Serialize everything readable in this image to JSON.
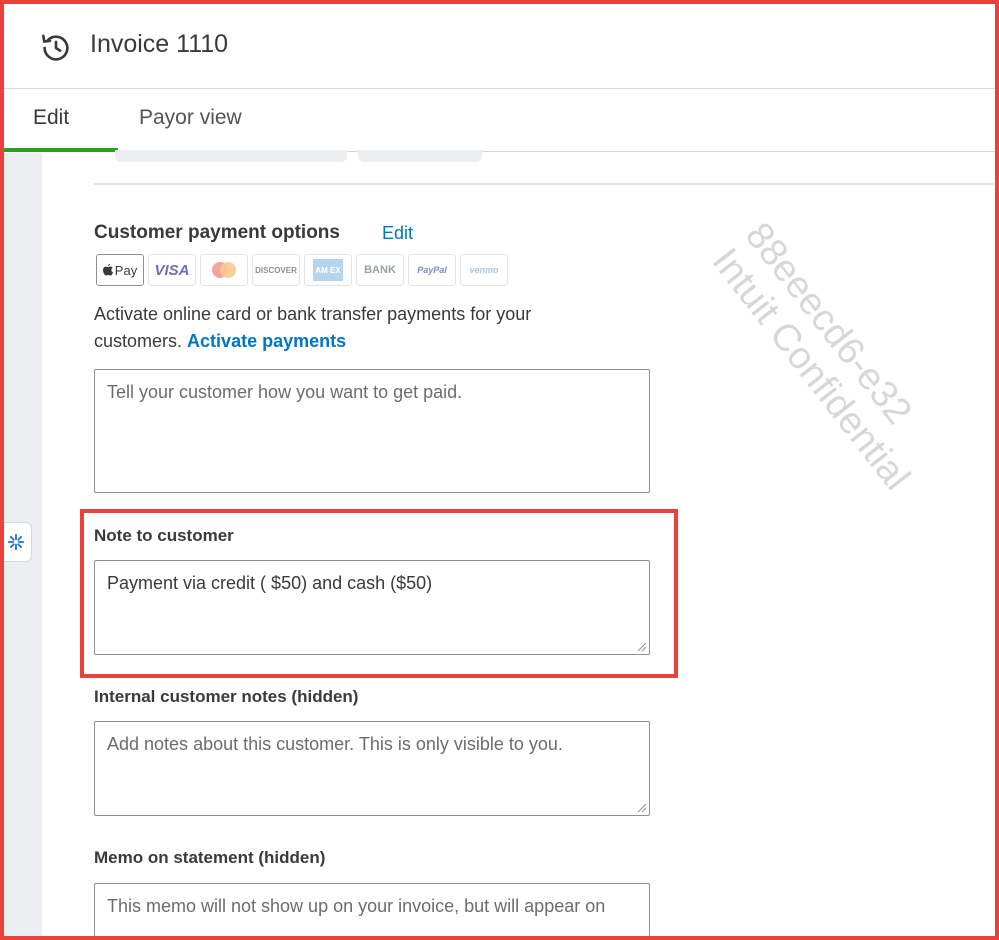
{
  "header": {
    "title": "Invoice 1110",
    "history_icon": "history-icon"
  },
  "tabs": [
    {
      "label": "Edit",
      "active": true
    },
    {
      "label": "Payor view",
      "active": false
    }
  ],
  "payment_options": {
    "title": "Customer payment options",
    "edit_label": "Edit",
    "icons": [
      {
        "name": "apple-pay",
        "label": "Pay"
      },
      {
        "name": "visa",
        "label": "VISA"
      },
      {
        "name": "mastercard",
        "label": ""
      },
      {
        "name": "discover",
        "label": "DISCOVER"
      },
      {
        "name": "amex",
        "label": "AM EX"
      },
      {
        "name": "bank",
        "label": "BANK"
      },
      {
        "name": "paypal",
        "label": "PayPal"
      },
      {
        "name": "venmo",
        "label": "venmo"
      }
    ],
    "activate_text": "Activate online card or bank transfer payments for your customers.",
    "activate_link": "Activate payments",
    "instructions_placeholder": "Tell your customer how you want to get paid."
  },
  "note_to_customer": {
    "label": "Note to customer",
    "value": "Payment via credit ( $50) and cash ($50)"
  },
  "internal_notes": {
    "label": "Internal customer notes (hidden)",
    "placeholder": "Add notes about this customer. This is only visible to you."
  },
  "memo": {
    "label": "Memo on statement (hidden)",
    "placeholder": "This memo will not show up on your invoice, but will appear on"
  },
  "watermark": {
    "line1": "88eeecd6-e32",
    "line2": "Intuit Confidential"
  },
  "colors": {
    "accent_green": "#2ca01c",
    "link_blue": "#0077c5",
    "highlight_red": "#e8423a"
  }
}
